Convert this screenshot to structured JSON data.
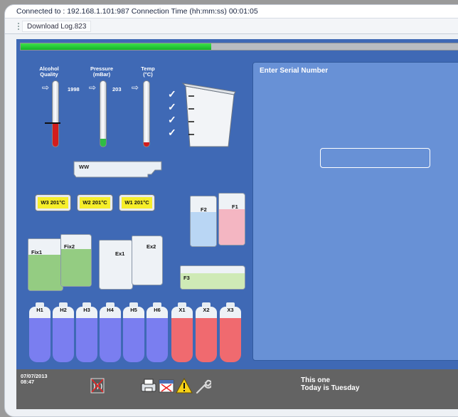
{
  "window": {
    "title": "Connected to : 192.168.1.101:987  Connection Time (hh:mm:ss) 00:01:05",
    "menu_item": "Download Log.823"
  },
  "progress": {
    "fraction": 0.42
  },
  "gauges": [
    {
      "label_line1": "Alcohol",
      "label_line2": "Quality",
      "value": "1998",
      "level": 0.35,
      "color": "#d21d1d"
    },
    {
      "label_line1": "Pressure",
      "label_line2": "(mBar)",
      "value": "203",
      "level": 0.12,
      "color": "#2fbd43"
    },
    {
      "label_line1": "Temp",
      "label_line2": "(°C)",
      "value": "",
      "level": 0.06,
      "color": "#d21d1d"
    }
  ],
  "ww_label": "WW",
  "warm_buttons": [
    "W3  201°C",
    "W2  201°C",
    "W1  201°C"
  ],
  "containers": {
    "f1": "F1",
    "f2": "F2",
    "f3": "F3",
    "fix1": "Fix1",
    "fix2": "Fix2",
    "ex1": "Ex1",
    "ex2": "Ex2"
  },
  "bottles": [
    {
      "label": "H1",
      "color": "#7a7ef0"
    },
    {
      "label": "H2",
      "color": "#7a7ef0"
    },
    {
      "label": "H3",
      "color": "#7a7ef0"
    },
    {
      "label": "H4",
      "color": "#7a7ef0"
    },
    {
      "label": "H5",
      "color": "#7a7ef0"
    },
    {
      "label": "H6",
      "color": "#7a7ef0"
    },
    {
      "label": "X1",
      "color": "#f06a6f"
    },
    {
      "label": "X2",
      "color": "#f06a6f"
    },
    {
      "label": "X3",
      "color": "#f06a6f"
    }
  ],
  "panel": {
    "title": "Enter Serial Number",
    "serial_value": ""
  },
  "status": {
    "date": "07/07/2013",
    "time": "08:47",
    "message_line1": "This one",
    "message_line2": "Today is Tuesday"
  },
  "icons": [
    "no-heat-icon",
    "printer-icon",
    "calendar-icon",
    "warning-icon",
    "wrench-icon"
  ]
}
